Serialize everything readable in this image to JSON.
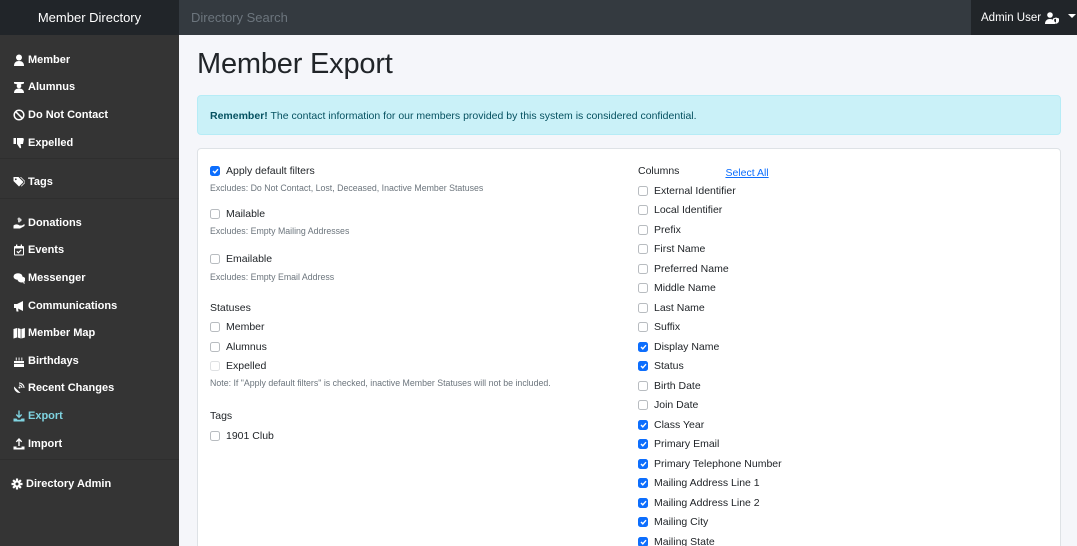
{
  "header": {
    "brand": "Member Directory",
    "search_placeholder": "Directory Search",
    "user_name": "Admin User",
    "user_icon": "user-shield-icon"
  },
  "sidebar": {
    "groups": [
      [
        {
          "label": "Member",
          "icon": "user-icon"
        },
        {
          "label": "Alumnus",
          "icon": "user-graduate-icon"
        },
        {
          "label": "Do Not Contact",
          "icon": "ban-icon"
        },
        {
          "label": "Expelled",
          "icon": "thumbs-down-icon"
        }
      ],
      [
        {
          "label": "Tags",
          "icon": "tags-icon"
        }
      ],
      [
        {
          "label": "Donations",
          "icon": "hand-holding-usd-icon"
        },
        {
          "label": "Events",
          "icon": "calendar-check-icon"
        },
        {
          "label": "Messenger",
          "icon": "comments-icon"
        },
        {
          "label": "Communications",
          "icon": "bullhorn-icon"
        },
        {
          "label": "Member Map",
          "icon": "map-icon"
        },
        {
          "label": "Birthdays",
          "icon": "birthday-cake-icon"
        },
        {
          "label": "Recent Changes",
          "icon": "satellite-dish-icon"
        },
        {
          "label": "Export",
          "icon": "download-icon",
          "active": true
        },
        {
          "label": "Import",
          "icon": "upload-icon"
        }
      ],
      [
        {
          "label": "Directory Admin",
          "icon": "cog-icon"
        }
      ]
    ],
    "active_color": "#7fd3e0"
  },
  "page": {
    "title": "Member Export",
    "alert_strong": "Remember!",
    "alert_text": " The contact information for our members provided by this system is considered confidential."
  },
  "filters": {
    "apply_default": {
      "label": "Apply default filters",
      "checked": true,
      "hint": "Excludes: Do Not Contact, Lost, Deceased, Inactive Member Statuses"
    },
    "mailable": {
      "label": "Mailable",
      "checked": false,
      "hint": "Excludes: Empty Mailing Addresses"
    },
    "emailable": {
      "label": "Emailable",
      "checked": false,
      "hint": "Excludes: Empty Email Address"
    },
    "statuses_label": "Statuses",
    "statuses": [
      {
        "label": "Member",
        "checked": false
      },
      {
        "label": "Alumnus",
        "checked": false
      },
      {
        "label": "Expelled",
        "checked": false,
        "disabled": true
      }
    ],
    "statuses_note": "Note: If \"Apply default filters\" is checked, inactive Member Statuses will not be included.",
    "tags_label": "Tags",
    "tags": [
      {
        "label": "1901 Club",
        "checked": false
      }
    ]
  },
  "columns": {
    "label": "Columns",
    "select_all": "Select All",
    "items": [
      {
        "label": "External Identifier",
        "checked": false
      },
      {
        "label": "Local Identifier",
        "checked": false
      },
      {
        "label": "Prefix",
        "checked": false
      },
      {
        "label": "First Name",
        "checked": false
      },
      {
        "label": "Preferred Name",
        "checked": false
      },
      {
        "label": "Middle Name",
        "checked": false
      },
      {
        "label": "Last Name",
        "checked": false
      },
      {
        "label": "Suffix",
        "checked": false
      },
      {
        "label": "Display Name",
        "checked": true
      },
      {
        "label": "Status",
        "checked": true
      },
      {
        "label": "Birth Date",
        "checked": false
      },
      {
        "label": "Join Date",
        "checked": false
      },
      {
        "label": "Class Year",
        "checked": true
      },
      {
        "label": "Primary Email",
        "checked": true
      },
      {
        "label": "Primary Telephone Number",
        "checked": true
      },
      {
        "label": "Mailing Address Line 1",
        "checked": true
      },
      {
        "label": "Mailing Address Line 2",
        "checked": true
      },
      {
        "label": "Mailing City",
        "checked": true
      },
      {
        "label": "Mailing State",
        "checked": true
      }
    ]
  }
}
